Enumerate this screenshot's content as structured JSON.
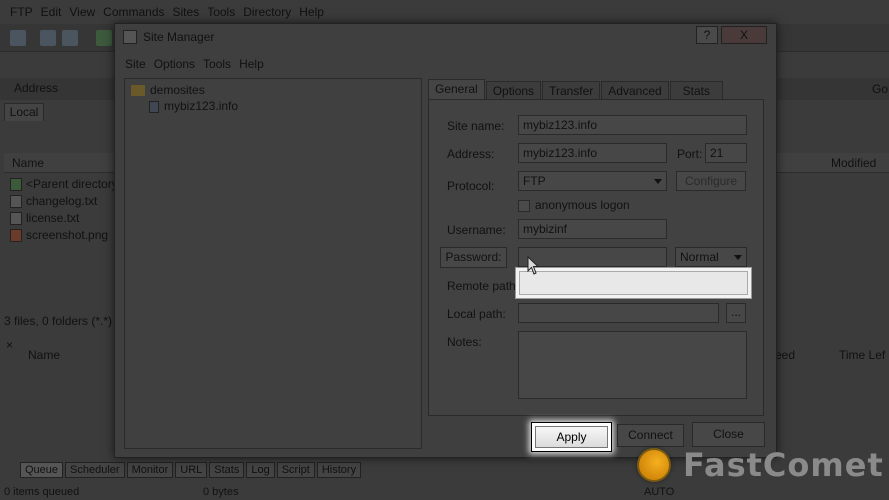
{
  "app": {
    "menu": [
      "FTP",
      "Edit",
      "View",
      "Commands",
      "Sites",
      "Tools",
      "Directory",
      "Help"
    ],
    "address_label": "Address",
    "go_label": "Go",
    "local_tab": "Local",
    "name_header": "Name",
    "modified_header": "Modified",
    "files": [
      {
        "name": "<Parent directory>",
        "icon": "up-arrow-icon"
      },
      {
        "name": "changelog.txt",
        "icon": "text-file-icon"
      },
      {
        "name": "license.txt",
        "icon": "text-file-icon"
      },
      {
        "name": "screenshot.png",
        "icon": "image-file-icon"
      }
    ],
    "local_status": "3 files, 0 folders (*.*)",
    "queue_name_header": "Name",
    "queue_speed_header": "eed",
    "queue_time_header": "Time Lef",
    "queue_tabs": [
      "Queue",
      "Scheduler",
      "Monitor",
      "URL",
      "Stats",
      "Log",
      "Script",
      "History"
    ],
    "footer_items": "0 items queued",
    "footer_bytes": "0 bytes",
    "footer_auto": "AUTO"
  },
  "dialog": {
    "title": "Site Manager",
    "help_btn": "?",
    "close_btn": "X",
    "menu": [
      "Site",
      "Options",
      "Tools",
      "Help"
    ],
    "tree": {
      "folder": "demosites",
      "site": "mybiz123.info"
    },
    "tabs": [
      "General",
      "Options",
      "Transfer",
      "Advanced",
      "Stats"
    ],
    "active_tab": "General",
    "site_name_label": "Site name:",
    "site_name": "mybiz123.info",
    "address_label": "Address:",
    "address": "mybiz123.info",
    "port_label": "Port:",
    "port": "21",
    "protocol_label": "Protocol:",
    "protocol": "FTP",
    "configure_label": "Configure",
    "anonymous_label": "anonymous logon",
    "username_label": "Username:",
    "username": "mybizinf",
    "password_btn": "Password:",
    "password": "",
    "password_mode": "Normal",
    "remote_path_label": "Remote path:",
    "local_path_label": "Local path:",
    "browse_label": "...",
    "notes_label": "Notes:",
    "apply_label": "Apply",
    "connect_label": "Connect",
    "close_label": "Close"
  },
  "watermark": "FastComet",
  "colors": {
    "highlight": "#ffffff",
    "logo_orange": "#f5a623"
  }
}
